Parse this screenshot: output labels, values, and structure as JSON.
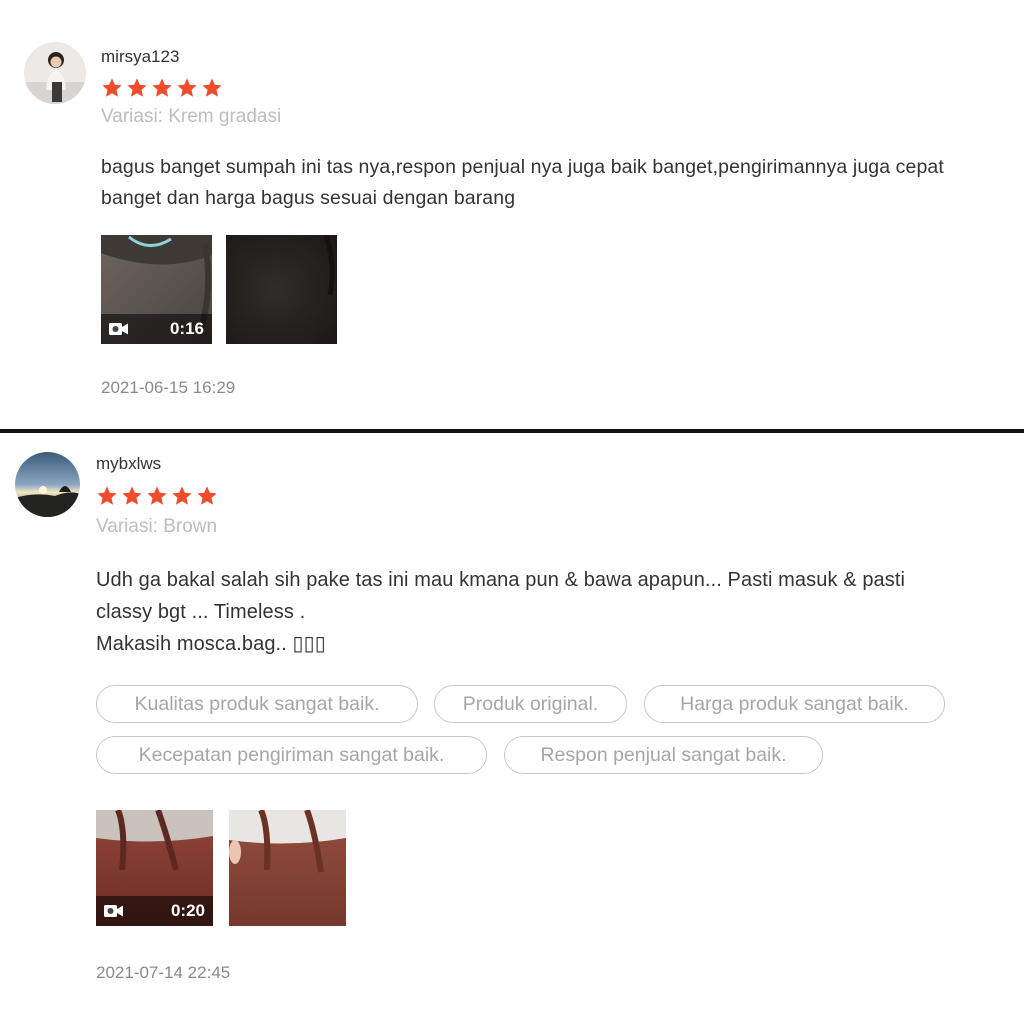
{
  "reviews": [
    {
      "username": "mirsya123",
      "rating": 5,
      "variation": "Variasi: Krem gradasi",
      "text_lines": [
        "bagus banget sumpah ini tas nya,respon penjual nya juga baik banget,pengirimannya juga cepat",
        "banget dan harga bagus sesuai dengan barang"
      ],
      "media": [
        {
          "kind": "video",
          "duration": "0:16"
        },
        {
          "kind": "image"
        }
      ],
      "timestamp": "2021-06-15 16:29"
    },
    {
      "username": "mybxlws",
      "rating": 5,
      "variation": "Variasi: Brown",
      "text_lines": [
        "Udh ga bakal salah sih pake tas ini mau kmana pun & bawa apapun... Pasti masuk & pasti",
        "classy bgt ... Timeless .",
        "Makasih mosca.bag.. ▯▯▯"
      ],
      "tags": [
        "Kualitas produk sangat baik.",
        "Produk original.",
        "Harga produk sangat baik.",
        "Kecepatan pengiriman sangat baik.",
        "Respon penjual sangat baik."
      ],
      "media": [
        {
          "kind": "video",
          "duration": "0:20"
        },
        {
          "kind": "image"
        }
      ],
      "timestamp": "2021-07-14 22:45"
    }
  ],
  "colors": {
    "star": "#ee4d2d",
    "variation": "#bdbdbd",
    "tag_border": "#c8c8c8",
    "divider": "#111111"
  },
  "icons": [
    "star-icon",
    "video-camera-icon"
  ]
}
